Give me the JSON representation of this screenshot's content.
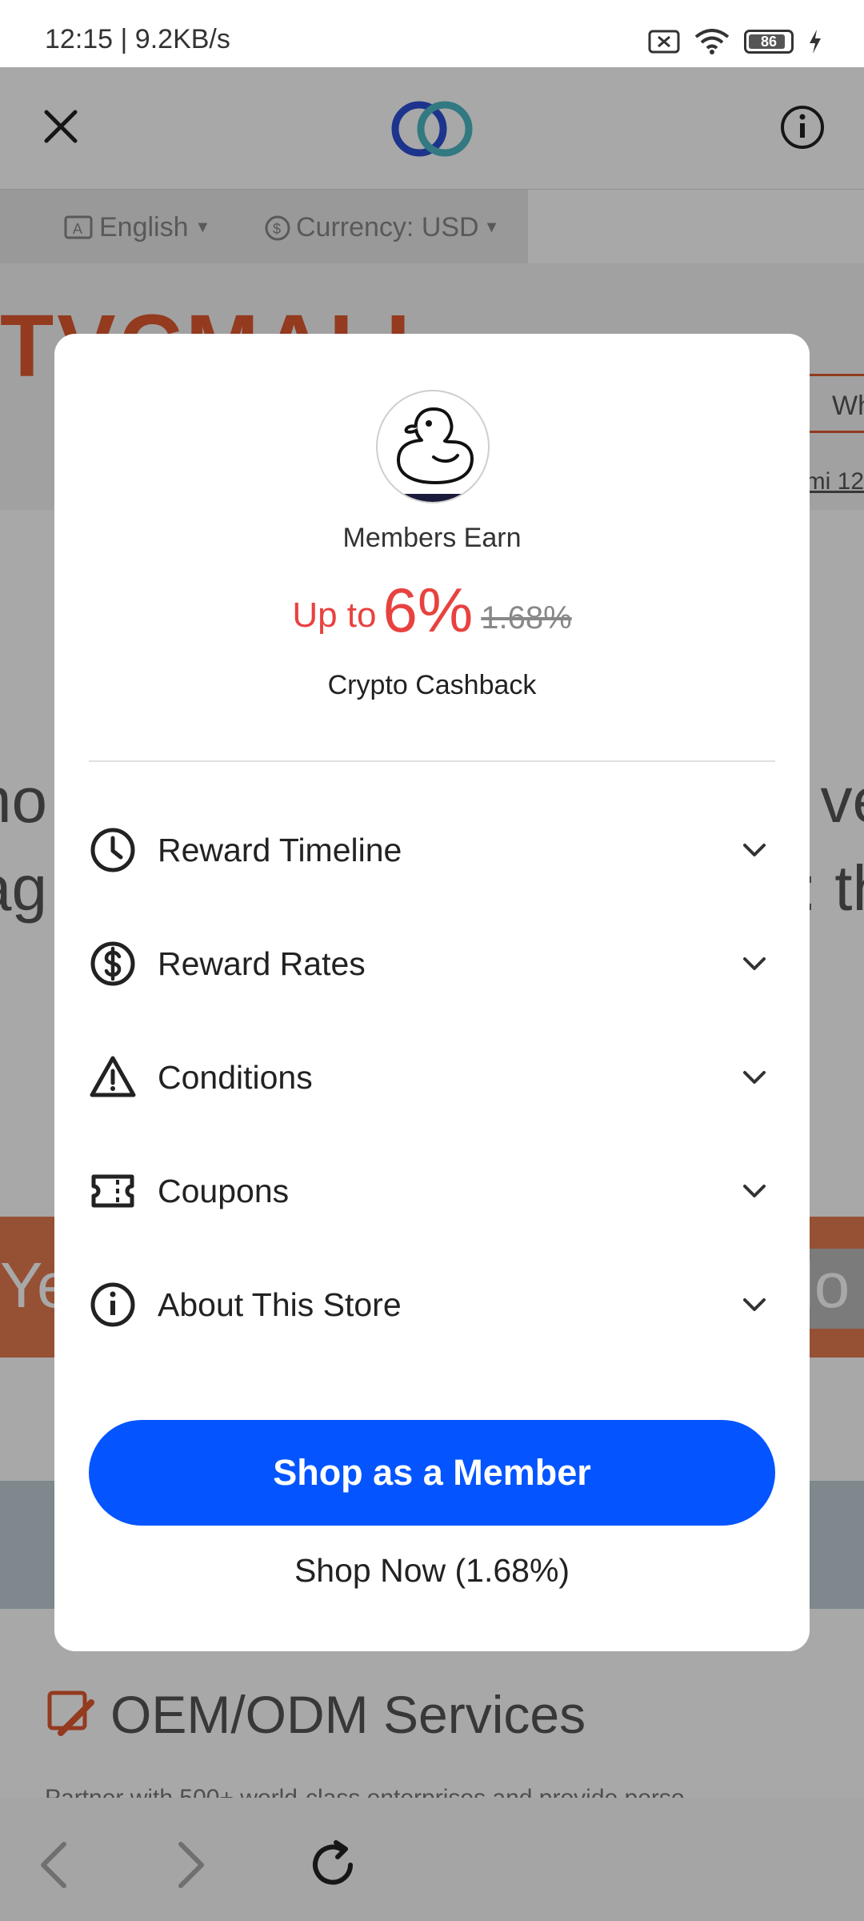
{
  "status_bar": {
    "time": "12:15 | 9.2KB/s",
    "battery_level": "86",
    "icons": [
      "sim-off-icon",
      "wifi-icon",
      "battery-icon",
      "charging-icon"
    ]
  },
  "browser": {
    "close_icon": "close-icon",
    "logo_icon": "sg-logo-icon",
    "info_icon": "info-icon",
    "language": "English",
    "currency": "Currency: USD",
    "store_brand": "TVCMALL",
    "search_partial": "Wh",
    "link_partial": "mi 12",
    "headline_line1_left": "ho",
    "headline_line1_right": "ve",
    "headline_line2_left": "ag",
    "headline_line2_right": ": th",
    "band_left": "Ye",
    "band_right": "lo",
    "services_title": "OEM/ODM Services",
    "services_sub": "Partner with 500+ world-class enterprises and provide perso",
    "nav_icons": [
      "back-icon",
      "forward-icon",
      "reload-icon"
    ]
  },
  "modal": {
    "avatar_icon": "duck-icon",
    "members_earn": "Members Earn",
    "up_to": "Up to",
    "rate": "6%",
    "old_rate": "1.68%",
    "cashback": "Crypto Cashback",
    "rows": [
      {
        "label": "Reward Timeline",
        "icon": "clock-icon"
      },
      {
        "label": "Reward Rates",
        "icon": "dollar-icon"
      },
      {
        "label": "Conditions",
        "icon": "warning-icon"
      },
      {
        "label": "Coupons",
        "icon": "ticket-icon"
      },
      {
        "label": "About This Store",
        "icon": "info-icon"
      }
    ],
    "primary_button": "Shop as a Member",
    "secondary_button": "Shop Now (1.68%)"
  },
  "colors": {
    "primary": "#0455ff",
    "accent_red": "#e8423f",
    "brand_orange": "#e0582f"
  }
}
